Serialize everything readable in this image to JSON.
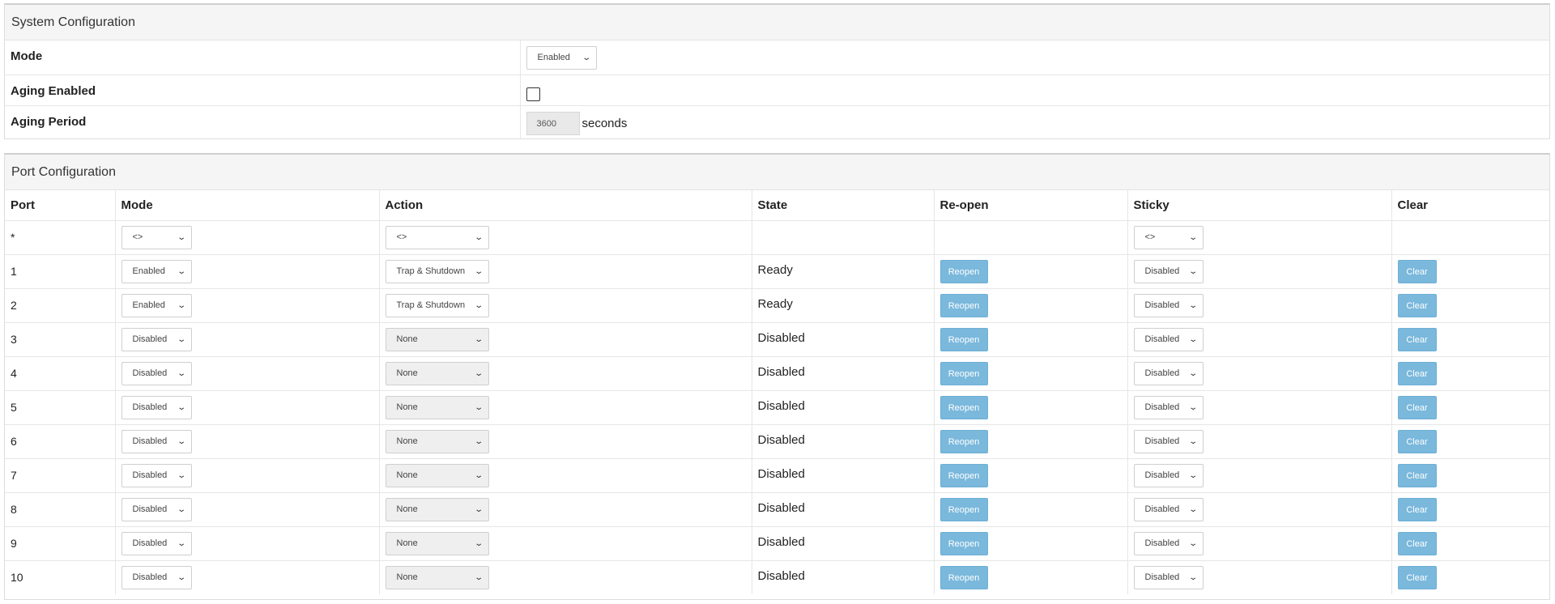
{
  "system": {
    "title": "System Configuration",
    "rows": {
      "mode": {
        "label": "Mode",
        "value": "Enabled"
      },
      "aging_enabled": {
        "label": "Aging Enabled",
        "checked": false
      },
      "aging_period": {
        "label": "Aging Period",
        "value": "3600",
        "unit": "seconds"
      }
    }
  },
  "ports": {
    "title": "Port Configuration",
    "headers": {
      "port": "Port",
      "mode": "Mode",
      "action": "Action",
      "state": "State",
      "reopen": "Re-open",
      "sticky": "Sticky",
      "clear": "Clear"
    },
    "all_row": {
      "port": "*",
      "mode": "<>",
      "action": "<>",
      "sticky": "<>"
    },
    "reopen_label": "Reopen",
    "clear_label": "Clear",
    "rows": [
      {
        "port": "1",
        "mode": "Enabled",
        "action": "Trap & Shutdown",
        "state": "Ready",
        "sticky": "Disabled"
      },
      {
        "port": "2",
        "mode": "Enabled",
        "action": "Trap & Shutdown",
        "state": "Ready",
        "sticky": "Disabled"
      },
      {
        "port": "3",
        "mode": "Disabled",
        "action": "None",
        "state": "Disabled",
        "sticky": "Disabled"
      },
      {
        "port": "4",
        "mode": "Disabled",
        "action": "None",
        "state": "Disabled",
        "sticky": "Disabled"
      },
      {
        "port": "5",
        "mode": "Disabled",
        "action": "None",
        "state": "Disabled",
        "sticky": "Disabled"
      },
      {
        "port": "6",
        "mode": "Disabled",
        "action": "None",
        "state": "Disabled",
        "sticky": "Disabled"
      },
      {
        "port": "7",
        "mode": "Disabled",
        "action": "None",
        "state": "Disabled",
        "sticky": "Disabled"
      },
      {
        "port": "8",
        "mode": "Disabled",
        "action": "None",
        "state": "Disabled",
        "sticky": "Disabled"
      },
      {
        "port": "9",
        "mode": "Disabled",
        "action": "None",
        "state": "Disabled",
        "sticky": "Disabled"
      },
      {
        "port": "10",
        "mode": "Disabled",
        "action": "None",
        "state": "Disabled",
        "sticky": "Disabled"
      }
    ]
  },
  "colors": {
    "button": "#7ab8dc",
    "heading_bg": "#f5f5f5"
  }
}
